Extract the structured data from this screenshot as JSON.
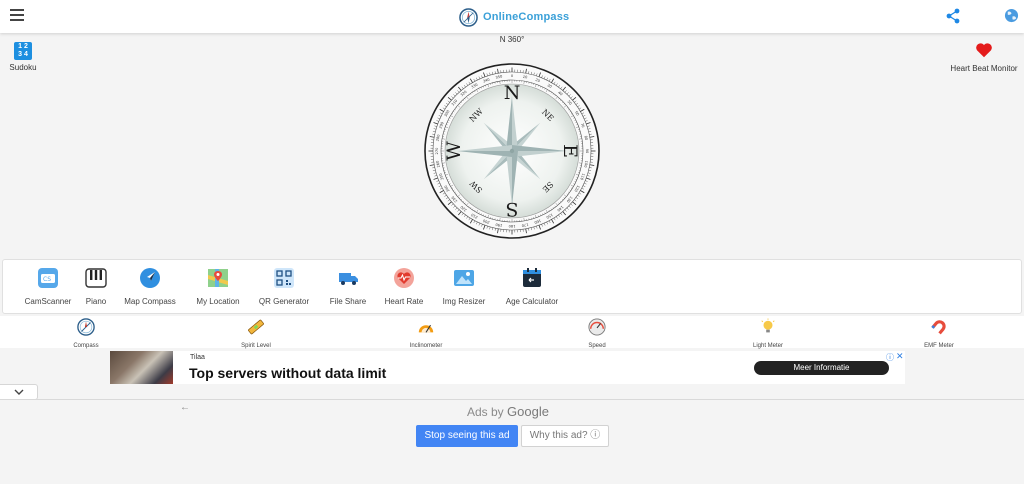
{
  "header": {
    "brand": "OnlineCompass",
    "menu_icon": "hamburger-menu-icon",
    "share_icon": "share-icon",
    "globe_icon": "globe-icon",
    "accent": "#3aa0d8"
  },
  "heading_readout": "N 360°",
  "corner_left": {
    "label": "Sudoku",
    "tile": [
      "1 2",
      "3 4"
    ]
  },
  "corner_right": {
    "label": "Heart Beat Monitor"
  },
  "compass": {
    "cardinals": [
      "N",
      "E",
      "S",
      "W"
    ],
    "intercardinals": [
      "NE",
      "SE",
      "SW",
      "NW"
    ],
    "dial_labels": [
      "0",
      "10",
      "20",
      "30",
      "40",
      "50",
      "60",
      "70",
      "80",
      "90",
      "100",
      "110",
      "120",
      "130",
      "140",
      "150",
      "160",
      "170",
      "180",
      "190",
      "200",
      "210",
      "220",
      "230",
      "240",
      "250",
      "260",
      "270",
      "280",
      "290",
      "300",
      "310",
      "320",
      "330",
      "340",
      "350"
    ]
  },
  "apps": [
    {
      "label": "CamScanner",
      "icon": "camscanner-icon"
    },
    {
      "label": "Piano",
      "icon": "piano-icon"
    },
    {
      "label": "Map Compass",
      "icon": "map-compass-icon"
    },
    {
      "label": "My Location",
      "icon": "map-location-icon"
    },
    {
      "label": "QR Generator",
      "icon": "qr-code-icon"
    },
    {
      "label": "File Share",
      "icon": "file-share-truck-icon"
    },
    {
      "label": "Heart Rate",
      "icon": "heart-rate-icon"
    },
    {
      "label": "Img Resizer",
      "icon": "image-icon"
    },
    {
      "label": "Age Calculator",
      "icon": "calendar-icon"
    }
  ],
  "tools": [
    {
      "label": "Compass",
      "icon": "compass-icon"
    },
    {
      "label": "Spirit Level",
      "icon": "spirit-level-icon"
    },
    {
      "label": "Inclinometer",
      "icon": "inclinometer-icon"
    },
    {
      "label": "Speed",
      "icon": "speedometer-icon"
    },
    {
      "label": "Light Meter",
      "icon": "light-bulb-icon"
    },
    {
      "label": "EMF Meter",
      "icon": "magnet-icon"
    }
  ],
  "ad": {
    "brand": "Tilaa",
    "title": "Top servers without data limit",
    "cta": "Meer Informatie"
  },
  "ad_footer": {
    "ads_by": "Ads by",
    "google": "Google",
    "stop_label": "Stop seeing this ad",
    "why_label": "Why this ad? ⓘ"
  }
}
